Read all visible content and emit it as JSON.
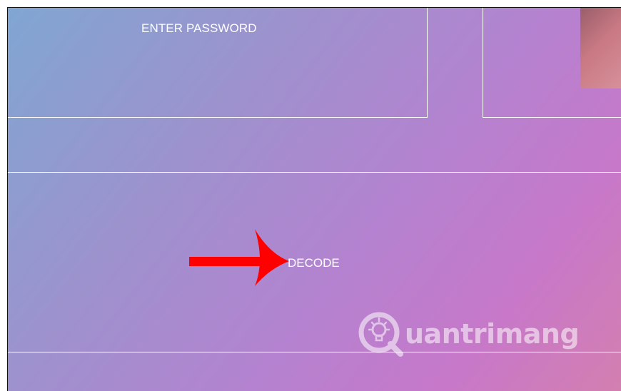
{
  "password_panel": {
    "label": "ENTER PASSWORD"
  },
  "decode": {
    "label": "DECODE"
  },
  "annotation": {
    "arrow_color": "#ff0000"
  },
  "watermark": {
    "text": "uantrimang",
    "icon": "lightbulb-q-icon"
  },
  "colors": {
    "gradient_start": "#80a6d2",
    "gradient_mid": "#b383d0",
    "gradient_end": "#d37fb0",
    "border": "#ffffff",
    "text": "#ffffff"
  }
}
